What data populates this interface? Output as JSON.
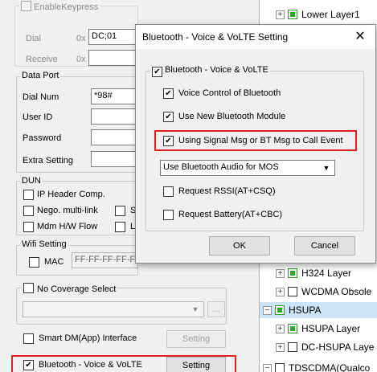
{
  "left": {
    "enable_keypress": "EnableKeypress",
    "dial_label": "Dial",
    "dial_prefix": "0x",
    "dial_value": "DC;01",
    "receive_label": "Receive",
    "receive_prefix": "0x",
    "data_port": {
      "title": "Data Port",
      "dial_num_label": "Dial Num",
      "dial_num_value": "*98#",
      "user_id_label": "User ID",
      "password_label": "Password",
      "extra_label": "Extra Setting"
    },
    "dun": {
      "title": "DUN",
      "ip_header": "IP Header Comp.",
      "nego": "Nego. multi-link",
      "nego_s": "S",
      "mdm": "Mdm H/W Flow",
      "mdm_l": "L"
    },
    "wifi": {
      "title": "Wifi Setting",
      "mac_label": "MAC",
      "mac_value": "FF-FF-FF-FF-FF-FF"
    },
    "no_coverage": "No Coverage Select",
    "no_coverage_btn": "...",
    "smart_dm": "Smart DM(App) Interface",
    "smart_dm_btn": "Setting",
    "bt_volte": "Bluetooth - Voice & VoLTE",
    "bt_volte_btn": "Setting"
  },
  "tree": {
    "items": [
      {
        "label": "Lower Layer1",
        "expander": "+",
        "checked": true
      },
      {
        "label": "H324 Layer",
        "expander": "+",
        "checked": true
      },
      {
        "label": "WCDMA Obsole",
        "expander": "+",
        "checked": false
      },
      {
        "label": "HSUPA",
        "expander": "−",
        "checked": true
      },
      {
        "label": "HSUPA Layer",
        "expander": "+",
        "checked": true
      },
      {
        "label": "DC-HSUPA Laye",
        "expander": "+",
        "checked": false
      },
      {
        "label": "TDSCDMA(Qualco",
        "expander": "−",
        "checked": false
      }
    ]
  },
  "dialog": {
    "title": "Bluetooth - Voice & VoLTE Setting",
    "close": "✕",
    "group_label": "Bluetooth - Voice & VoLTE",
    "voice_control": "Voice Control of Bluetooth",
    "new_module": "Use New Bluetooth Module",
    "signal_msg": "Using Signal Msg or BT Msg to Call Event",
    "audio_select": "Use Bluetooth Audio for MOS",
    "rssi": "Request RSSI(AT+CSQ)",
    "battery": "Request Battery(AT+CBC)",
    "ok": "OK",
    "cancel": "Cancel"
  },
  "colors": {
    "highlight": "#e02020",
    "tree_check": "#2fa82f",
    "tree_selected": "#cce4f7"
  }
}
